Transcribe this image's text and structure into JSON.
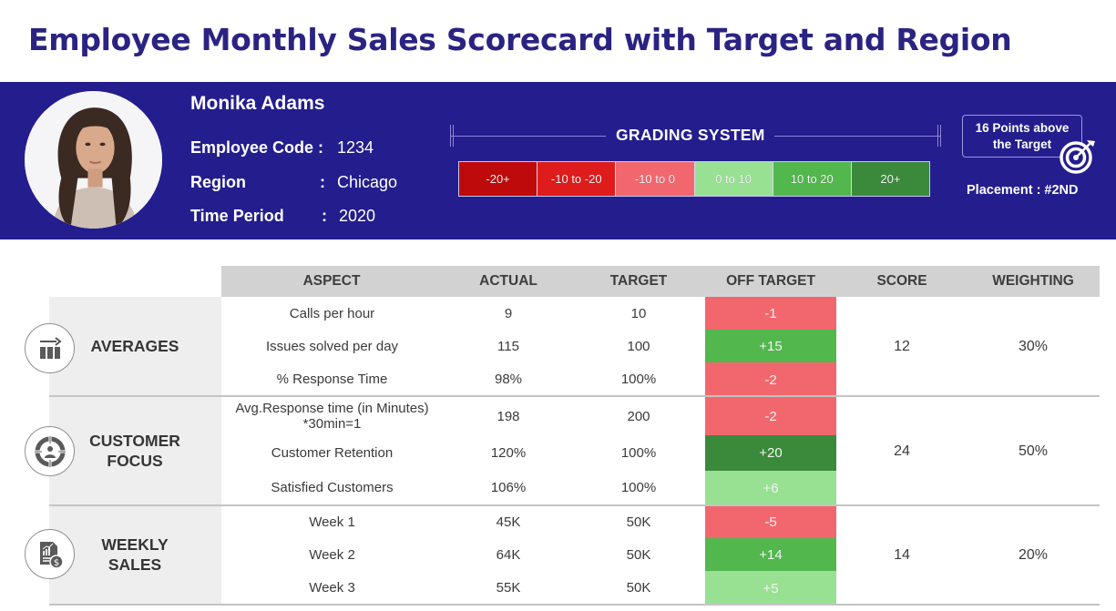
{
  "title": "Employee Monthly Sales Scorecard with Target and Region",
  "employee": {
    "name": "Monika Adams",
    "fields": [
      {
        "label": "Employee Code",
        "value": "1234"
      },
      {
        "label": "Region",
        "value": "Chicago"
      },
      {
        "label": "Time Period",
        "value": "2020"
      }
    ],
    "colon": ":"
  },
  "grading": {
    "title": "GRADING SYSTEM",
    "scale": [
      {
        "label": "-20+",
        "color": "#be0a0a"
      },
      {
        "label": "-10 to -20",
        "color": "#de1c1c"
      },
      {
        "label": "-10 to 0",
        "color": "#f2676e"
      },
      {
        "label": "0 to 10",
        "color": "#98e193"
      },
      {
        "label": "10 to 20",
        "color": "#52b74d"
      },
      {
        "label": "20+",
        "color": "#3b8a3b"
      }
    ]
  },
  "summary": {
    "points_text": "16 Points above the Target",
    "points_line1": "16 Points above",
    "points_line2": "the Target",
    "placement_label": "Placement",
    "placement_value": "#2ND",
    "placement_text": "Placement  :  #2ND"
  },
  "table": {
    "headers": [
      "ASPECT",
      "ACTUAL",
      "TARGET",
      "OFF TARGET",
      "SCORE",
      "WEIGHTING"
    ],
    "groups": [
      {
        "category": "AVERAGES",
        "category_line1": "AVERAGES",
        "category_line2": "",
        "icon": "bar-chart-arrow-icon",
        "score": "12",
        "weighting": "30%",
        "rows": [
          {
            "aspect": "Calls per hour",
            "aspect_line2": "",
            "actual": "9",
            "target": "10",
            "off_target": "-1",
            "off_color": "#f2676e"
          },
          {
            "aspect": "Issues  solved per day",
            "aspect_line2": "",
            "actual": "115",
            "target": "100",
            "off_target": "+15",
            "off_color": "#52b74d"
          },
          {
            "aspect": "% Response Time",
            "aspect_line2": "",
            "actual": "98%",
            "target": "100%",
            "off_target": "-2",
            "off_color": "#f2676e"
          }
        ]
      },
      {
        "category": "CUSTOMER FOCUS",
        "category_line1": "CUSTOMER",
        "category_line2": "FOCUS",
        "icon": "customer-target-icon",
        "score": "24",
        "weighting": "50%",
        "rows": [
          {
            "aspect": "Avg.Response time (in Minutes)",
            "aspect_line2": "*30min=1",
            "actual": "198",
            "target": "200",
            "off_target": "-2",
            "off_color": "#f2676e"
          },
          {
            "aspect": "Customer Retention",
            "aspect_line2": "",
            "actual": "120%",
            "target": "100%",
            "off_target": "+20",
            "off_color": "#3b8a3b"
          },
          {
            "aspect": "Satisfied Customers",
            "aspect_line2": "",
            "actual": "106%",
            "target": "100%",
            "off_target": "+6",
            "off_color": "#98e193"
          }
        ]
      },
      {
        "category": "WEEKLY SALES",
        "category_line1": "WEEKLY",
        "category_line2": "SALES",
        "icon": "sales-report-dollar-icon",
        "score": "14",
        "weighting": "20%",
        "rows": [
          {
            "aspect": "Week 1",
            "aspect_line2": "",
            "actual": "45K",
            "target": "50K",
            "off_target": "-5",
            "off_color": "#f2676e"
          },
          {
            "aspect": "Week 2",
            "aspect_line2": "",
            "actual": "64K",
            "target": "50K",
            "off_target": "+14",
            "off_color": "#52b74d"
          },
          {
            "aspect": "Week 3",
            "aspect_line2": "",
            "actual": "55K",
            "target": "50K",
            "off_target": "+5",
            "off_color": "#98e193"
          }
        ]
      }
    ]
  },
  "colors": {
    "title": "#2b2382",
    "band": "#231d8e",
    "header_row": "#d3d2d3",
    "category_panel": "#efeeef"
  }
}
